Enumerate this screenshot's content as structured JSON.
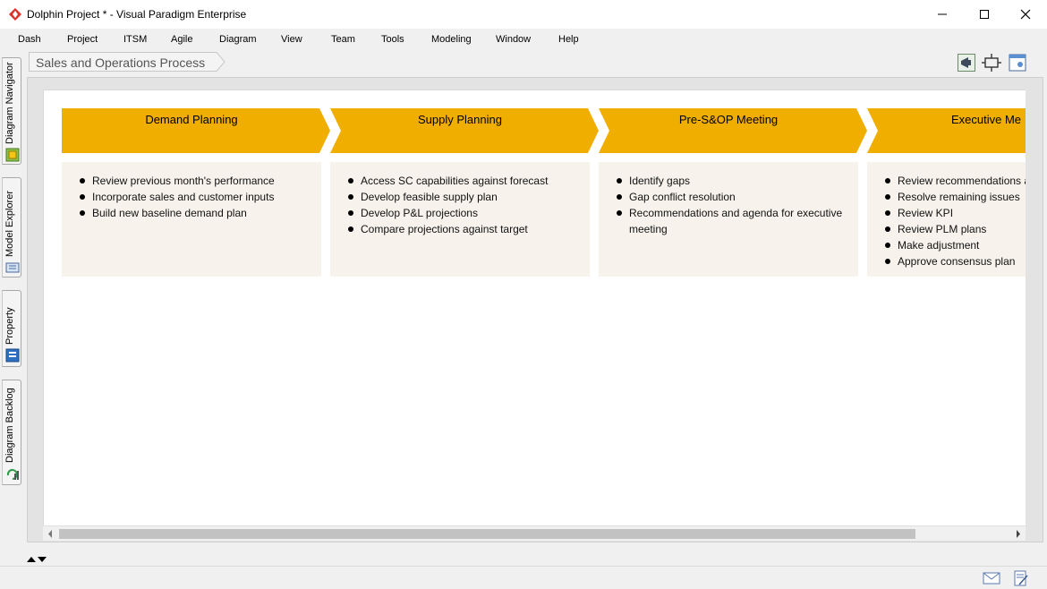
{
  "window": {
    "title": "Dolphin Project * - Visual Paradigm Enterprise"
  },
  "menu": [
    "Dash",
    "Project",
    "ITSM",
    "Agile",
    "Diagram",
    "View",
    "Team",
    "Tools",
    "Modeling",
    "Window",
    "Help"
  ],
  "breadcrumb": {
    "diagram_name": "Sales and Operations Process"
  },
  "side_tabs": [
    "Diagram Navigator",
    "Model Explorer",
    "Property",
    "Diagram Backlog"
  ],
  "stages": [
    {
      "title": "Demand Planning",
      "items": [
        "Review previous month's performance",
        "Incorporate sales and customer inputs",
        "Build new baseline demand plan"
      ]
    },
    {
      "title": "Supply Planning",
      "items": [
        "Access SC capabilities against forecast",
        "Develop feasible supply plan",
        "Develop P&L projections",
        "Compare projections against target"
      ]
    },
    {
      "title": "Pre-S&OP Meeting",
      "items": [
        "Identify gaps",
        "Gap conflict resolution",
        "Recommendations and agenda for executive meeting"
      ]
    },
    {
      "title": "Executive Me",
      "items": [
        "Review recommendations a",
        "Resolve remaining issues",
        "Review KPI",
        "Review PLM plans",
        "Make adjustment",
        "Approve consensus plan"
      ]
    }
  ],
  "colors": {
    "stage_header": "#f0ae00",
    "stage_body": "#f7f3ec",
    "app_icon": "#d9312b"
  },
  "icons": {
    "toolbar": [
      "megaphone-icon",
      "fit-frame-icon",
      "diagram-overview-icon"
    ],
    "status": [
      "mail-icon",
      "document-edit-icon"
    ]
  }
}
